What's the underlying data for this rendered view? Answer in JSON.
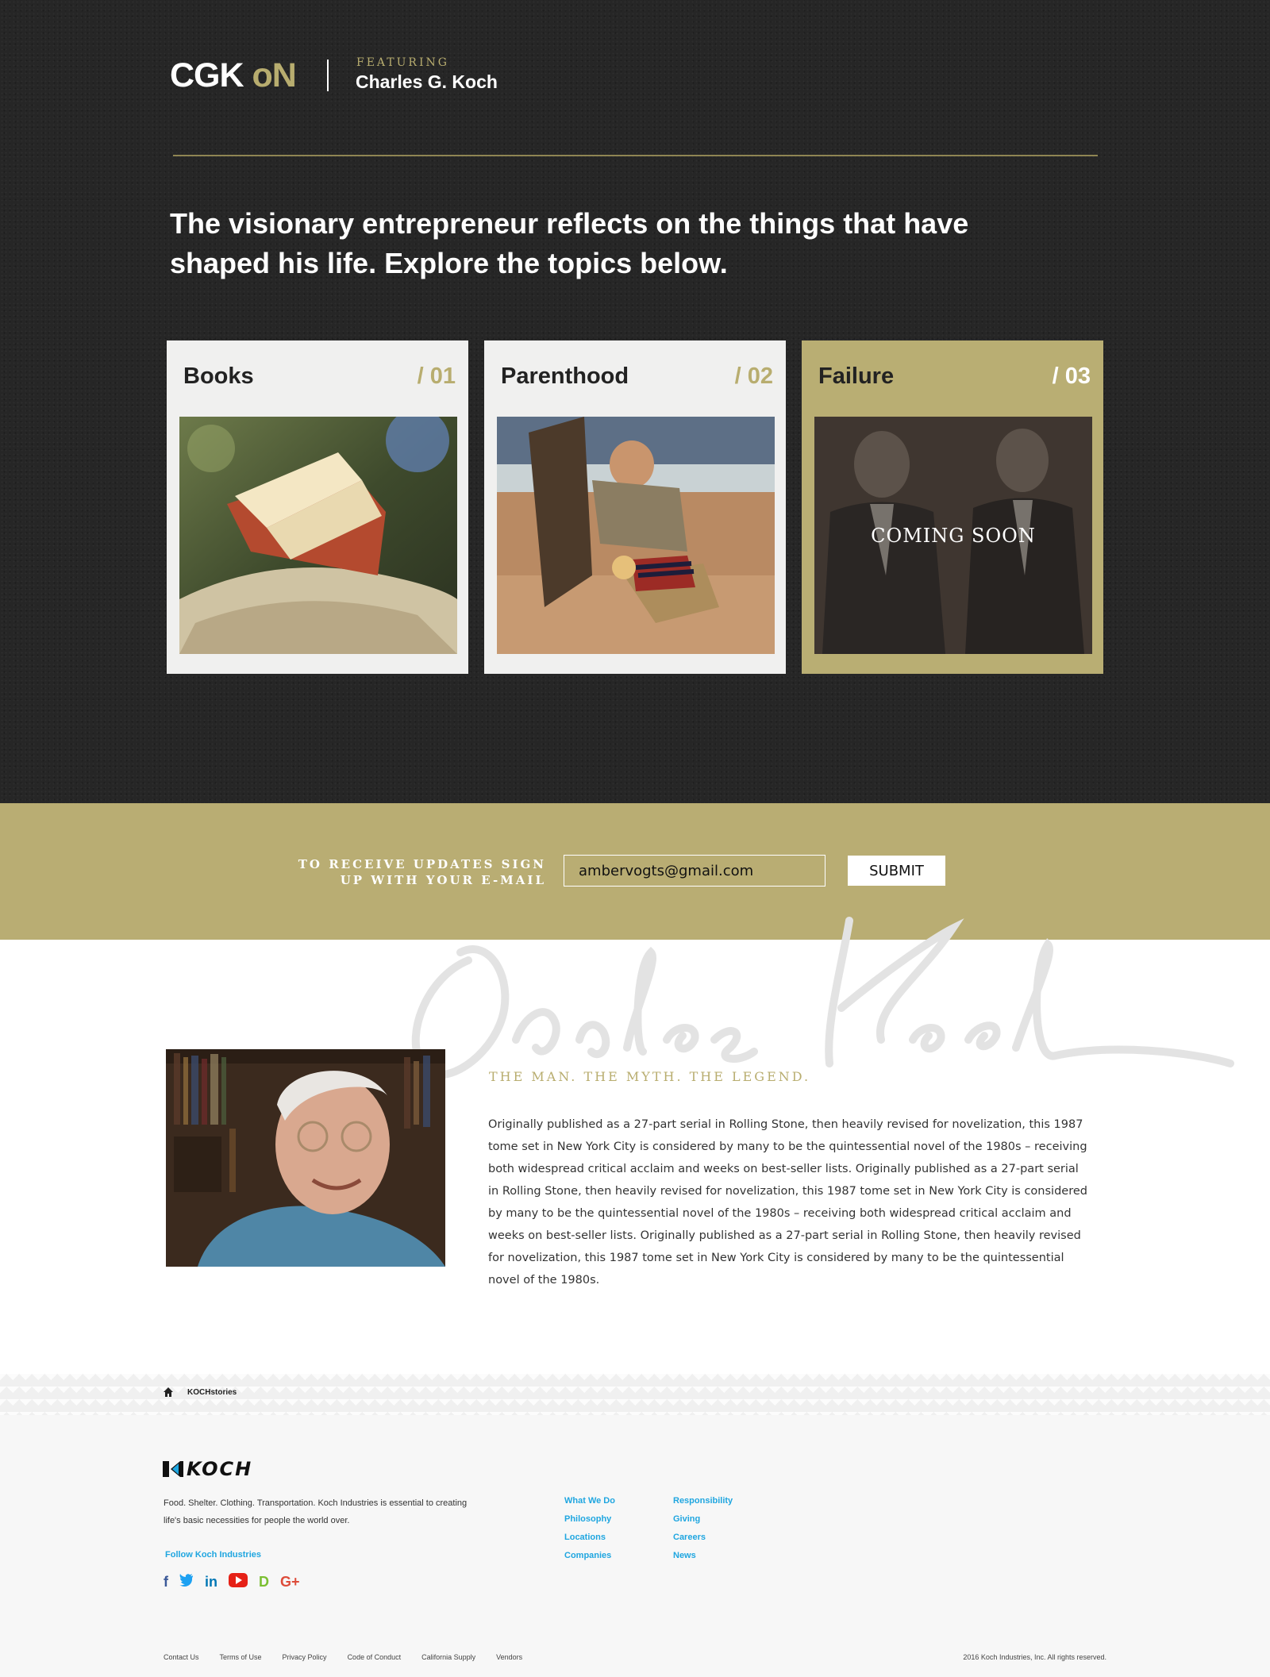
{
  "brand": {
    "logo_prefix": "CGK",
    "logo_suffix": "oN",
    "featuring_label": "FEATURING",
    "featured_name": "Charles G. Koch"
  },
  "hero": {
    "headline": "The visionary entrepreneur reflects on the things that have shaped his life. Explore the topics below."
  },
  "topics": [
    {
      "title": "Books",
      "number": "/ 01",
      "photo": "book-photo"
    },
    {
      "title": "Parenthood",
      "number": "/ 02",
      "photo": "beach-family-photo"
    },
    {
      "title": "Failure",
      "number": "/ 03",
      "photo": "two-men-photo",
      "overlay": "COMING SOON"
    }
  ],
  "signup": {
    "label_line1": "TO RECEIVE UPDATES SIGN",
    "label_line2": "UP WITH YOUR E-MAIL",
    "email_value": "ambervogts@gmail.com",
    "submit_label": "SUBMIT"
  },
  "about": {
    "tagline": "THE MAN. THE MYTH. THE LEGEND.",
    "bio": "Originally published as a 27-part serial in Rolling Stone, then heavily revised for novelization, this 1987 tome set in New York City is considered by many to be the quintessential novel of the 1980s – receiving both widespread critical acclaim and weeks on best-seller lists.  Originally published as a 27-part serial in Rolling Stone, then heavily revised for novelization, this 1987 tome set in New York City is considered by many to be the quintessential novel of the 1980s – receiving both widespread critical acclaim and weeks on best-seller lists.  Originally published as a 27-part serial in Rolling Stone, then heavily revised for novelization, this 1987 tome set in New York City is considered by many to be the quintessential novel of the 1980s."
  },
  "breadcrumb": {
    "icon": "home-icon",
    "label": "KOCHstories"
  },
  "footer": {
    "logo_text": "KOCH",
    "description": "Food. Shelter. Clothing. Transportation. Koch Industries is essential to creating life's basic necessities for people the world over.",
    "follow_label": "Follow Koch Industries",
    "social": [
      {
        "icon": "facebook-icon",
        "glyph": "f",
        "color": "#3b5998"
      },
      {
        "icon": "twitter-icon",
        "glyph": "t",
        "color": "#1da1f2"
      },
      {
        "icon": "linkedin-icon",
        "glyph": "in",
        "color": "#0077b5"
      },
      {
        "icon": "youtube-icon",
        "glyph": "▶",
        "color": "#e62117"
      },
      {
        "icon": "vine-icon",
        "glyph": "D",
        "color": "#7bbf32"
      },
      {
        "icon": "google-plus-icon",
        "glyph": "G+",
        "color": "#dd4b39"
      }
    ],
    "links_col1": [
      "What We Do",
      "Philosophy",
      "Locations",
      "Companies"
    ],
    "links_col2": [
      "Responsibility",
      "Giving",
      "Careers",
      "News"
    ],
    "legal_links": [
      "Contact Us",
      "Terms of Use",
      "Privacy Policy",
      "Code of Conduct",
      "California Supply",
      "Vendors"
    ],
    "copyright": "2016 Koch Industries, Inc. All rights reserved."
  },
  "colors": {
    "gold": "#b9ad73",
    "dark_bg": "#262626",
    "link_blue": "#1fa6e0"
  }
}
